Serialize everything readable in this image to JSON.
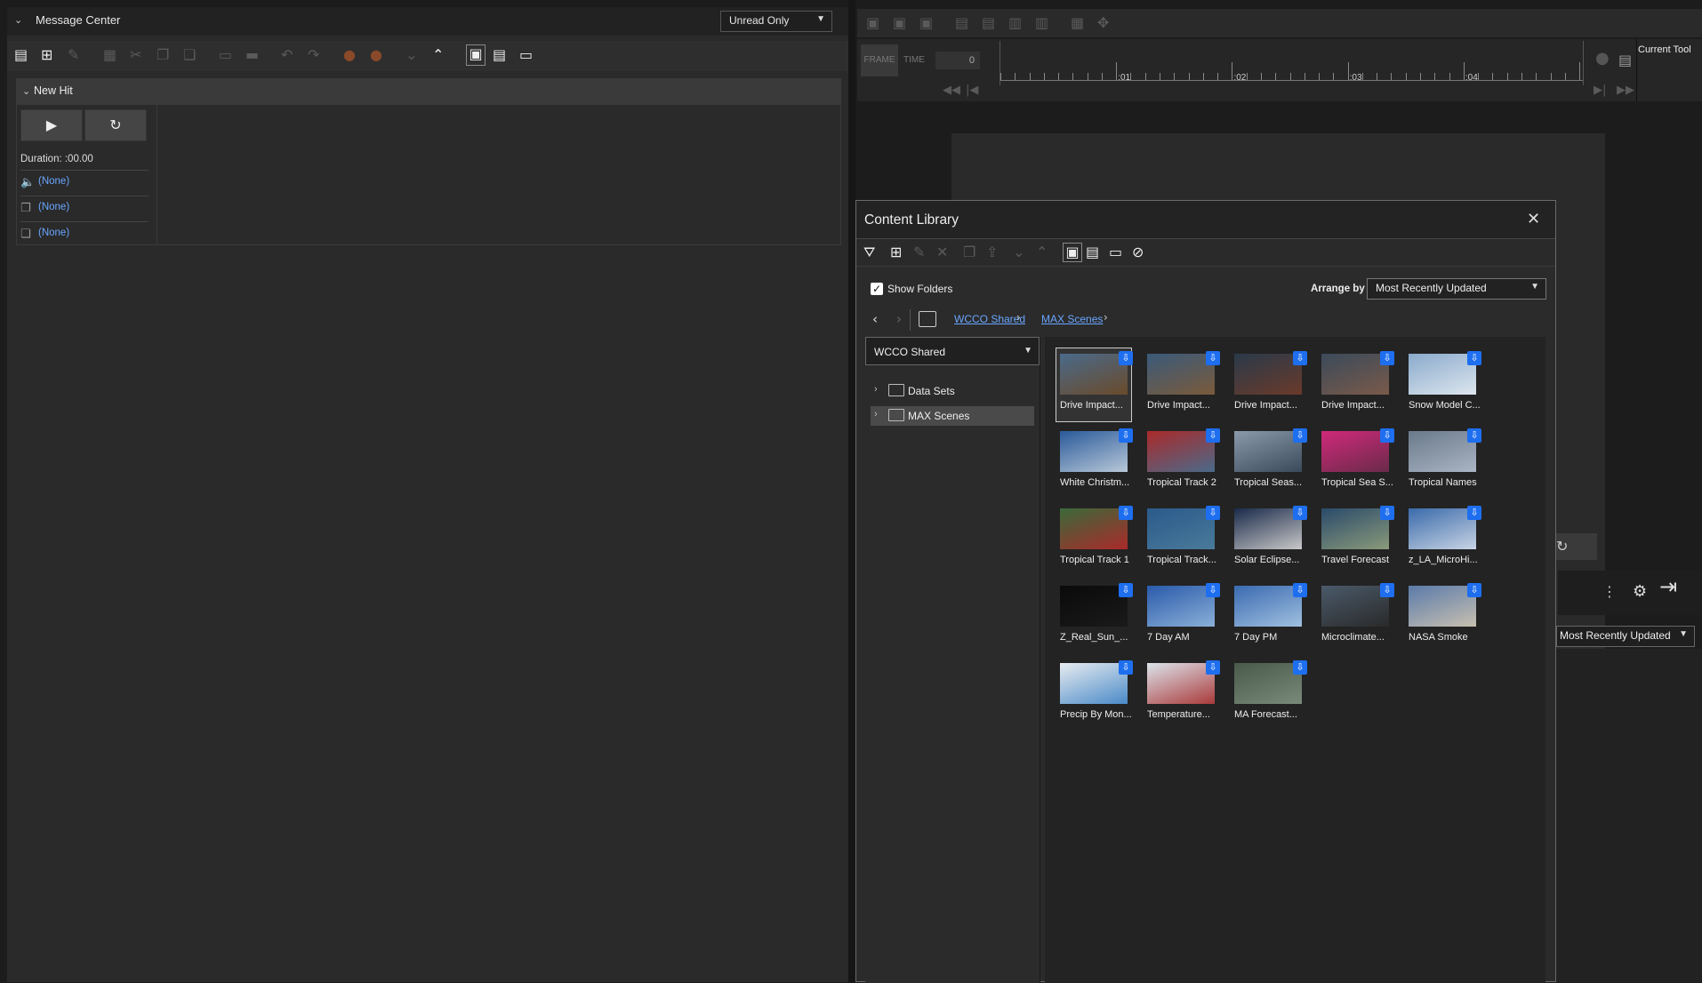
{
  "message_center": {
    "title": "Message Center",
    "filter": "Unread Only",
    "section_title": "New Hit",
    "duration": "Duration:  :00.00",
    "rows": [
      {
        "label": "(None)",
        "icon": "speaker-icon"
      },
      {
        "label": "(None)",
        "icon": "copy-document-icon"
      },
      {
        "label": "(None)",
        "icon": "paste-document-icon"
      }
    ]
  },
  "timeline": {
    "frame_label": "FRAME",
    "time_label": "TIME",
    "frame_value": "0",
    "ticks": [
      ":01",
      ":02",
      ":03",
      ":04"
    ],
    "current_tool": "Current Tool"
  },
  "right_panel": {
    "sort": "Most Recently Updated"
  },
  "content_library": {
    "title": "Content Library",
    "show_folders": "Show Folders",
    "arrange_by_label": "Arrange by",
    "arrange_by_value": "Most Recently Updated",
    "breadcrumb": [
      "WCCO Shared",
      "MAX Scenes"
    ],
    "folder_dropdown": "WCCO Shared",
    "tree": [
      {
        "name": "Data Sets",
        "selected": false
      },
      {
        "name": "MAX Scenes",
        "selected": true
      }
    ],
    "tiles": [
      {
        "label": "Drive Impact...",
        "colors": [
          "#4a6a8a",
          "#6a4a2a"
        ]
      },
      {
        "label": "Drive Impact...",
        "colors": [
          "#3a5a7a",
          "#7a5a3a"
        ]
      },
      {
        "label": "Drive Impact...",
        "colors": [
          "#2a3a4a",
          "#6a3a2a"
        ]
      },
      {
        "label": "Drive Impact...",
        "colors": [
          "#3a4a5a",
          "#7a5a4a"
        ]
      },
      {
        "label": "Snow Model C...",
        "colors": [
          "#8aaacc",
          "#dde6ee"
        ]
      },
      {
        "label": "White Christm...",
        "colors": [
          "#2a5a9a",
          "#b8c8d8"
        ]
      },
      {
        "label": "Tropical Track 2",
        "colors": [
          "#aa2a2a",
          "#4a6a8a"
        ]
      },
      {
        "label": "Tropical Seas...",
        "colors": [
          "#8a9aaa",
          "#3a4a5a"
        ]
      },
      {
        "label": "Tropical Sea S...",
        "colors": [
          "#d02a7a",
          "#6a2a4a"
        ]
      },
      {
        "label": "Tropical Names",
        "colors": [
          "#6a7a8a",
          "#aab4c4"
        ]
      },
      {
        "label": "Tropical Track 1",
        "colors": [
          "#3a6a3a",
          "#aa2a2a"
        ]
      },
      {
        "label": "Tropical Track...",
        "colors": [
          "#2a5a8a",
          "#4a7a9a"
        ]
      },
      {
        "label": "Solar Eclipse...",
        "colors": [
          "#1a2a4a",
          "#c8c8c8"
        ]
      },
      {
        "label": "Travel Forecast",
        "colors": [
          "#2a4a6a",
          "#8a9a7a"
        ]
      },
      {
        "label": "z_LA_MicroHi...",
        "colors": [
          "#3a6aaa",
          "#c8d4e4"
        ]
      },
      {
        "label": "Z_Real_Sun_...",
        "colors": [
          "#0a0a0a",
          "#1a1a1a"
        ]
      },
      {
        "label": "7 Day AM",
        "colors": [
          "#2a5aaa",
          "#8ab0d8"
        ]
      },
      {
        "label": "7 Day PM",
        "colors": [
          "#3a6ab0",
          "#a0c0e0"
        ]
      },
      {
        "label": "Microclimate...",
        "colors": [
          "#4a5a6a",
          "#2a2a2a"
        ]
      },
      {
        "label": "NASA Smoke",
        "colors": [
          "#5a7aaa",
          "#c8c0b0"
        ]
      },
      {
        "label": "Precip By Mon...",
        "colors": [
          "#e8ecf0",
          "#4a8ac8"
        ]
      },
      {
        "label": "Temperature...",
        "colors": [
          "#dce4ec",
          "#aa3a3a"
        ]
      },
      {
        "label": "MA Forecast...",
        "colors": [
          "#4a5a4a",
          "#7a8a7a"
        ]
      }
    ]
  }
}
